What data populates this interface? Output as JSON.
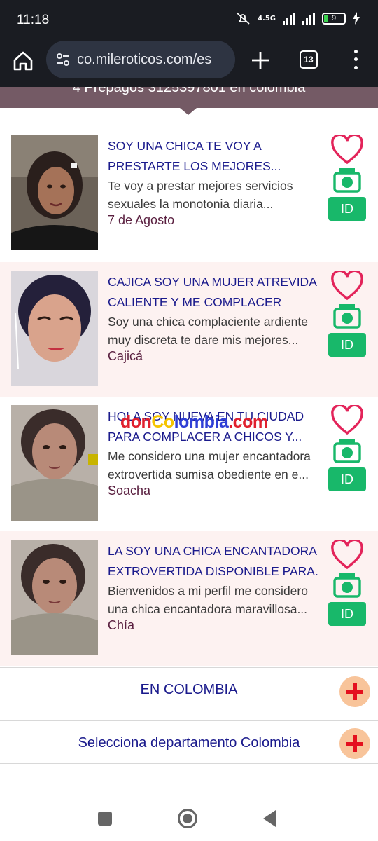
{
  "status_bar": {
    "time": "11:18",
    "network": "4.5G",
    "battery": "9"
  },
  "browser": {
    "url": "co.mileroticos.com/es",
    "tab_count": "13"
  },
  "banner": {
    "text": "4 Prepagos 3125397801 en colombia"
  },
  "listings": [
    {
      "title_line1": "SOY UNA CHICA TE VOY A",
      "title_line2": "PRESTARTE LOS MEJORES...",
      "desc_line1": "Te voy a prestar mejores servicios",
      "desc_line2": "sexuales la monotonia diaria...",
      "meta": "7 de Agosto",
      "id_label": "ID"
    },
    {
      "title_line1": "CAJICA SOY UNA MUJER ATREVIDA",
      "title_line2": "CALIENTE Y ME COMPLACER",
      "desc_line1": "Soy una chica complaciente ardiente",
      "desc_line2": "muy discreta te dare mis mejores...",
      "meta": "Cajicá",
      "id_label": "ID"
    },
    {
      "title_line1": "HOLA SOY NUEVA EN TU CIUDAD",
      "title_line2": "PARA COMPLACER A CHICOS Y...",
      "desc_line1": "Me considero una mujer encantadora",
      "desc_line2": "extrovertida sumisa obediente en e...",
      "meta": "Soacha",
      "id_label": "ID"
    },
    {
      "title_line1": "LA SOY UNA CHICA ENCANTADORA",
      "title_line2": "EXTROVERTIDA DISPONIBLE PARA...",
      "desc_line1": "Bienvenidos a mi perfil me considero",
      "desc_line2": "una chica encantadora maravillosa...",
      "meta": "Chía",
      "id_label": "ID"
    }
  ],
  "watermark": {
    "part1": "don",
    "part2": "Co",
    "part3": "lombia",
    "part4": ".com"
  },
  "sections": {
    "country": "EN COLOMBIA",
    "department": "Selecciona departamento Colombia"
  },
  "colors": {
    "title": "#1a1a8c",
    "id_button": "#18b86a",
    "heart": "#e3245a",
    "camera": "#18b86a",
    "banner": "#745a65",
    "alt_row": "#fdf2f1"
  }
}
